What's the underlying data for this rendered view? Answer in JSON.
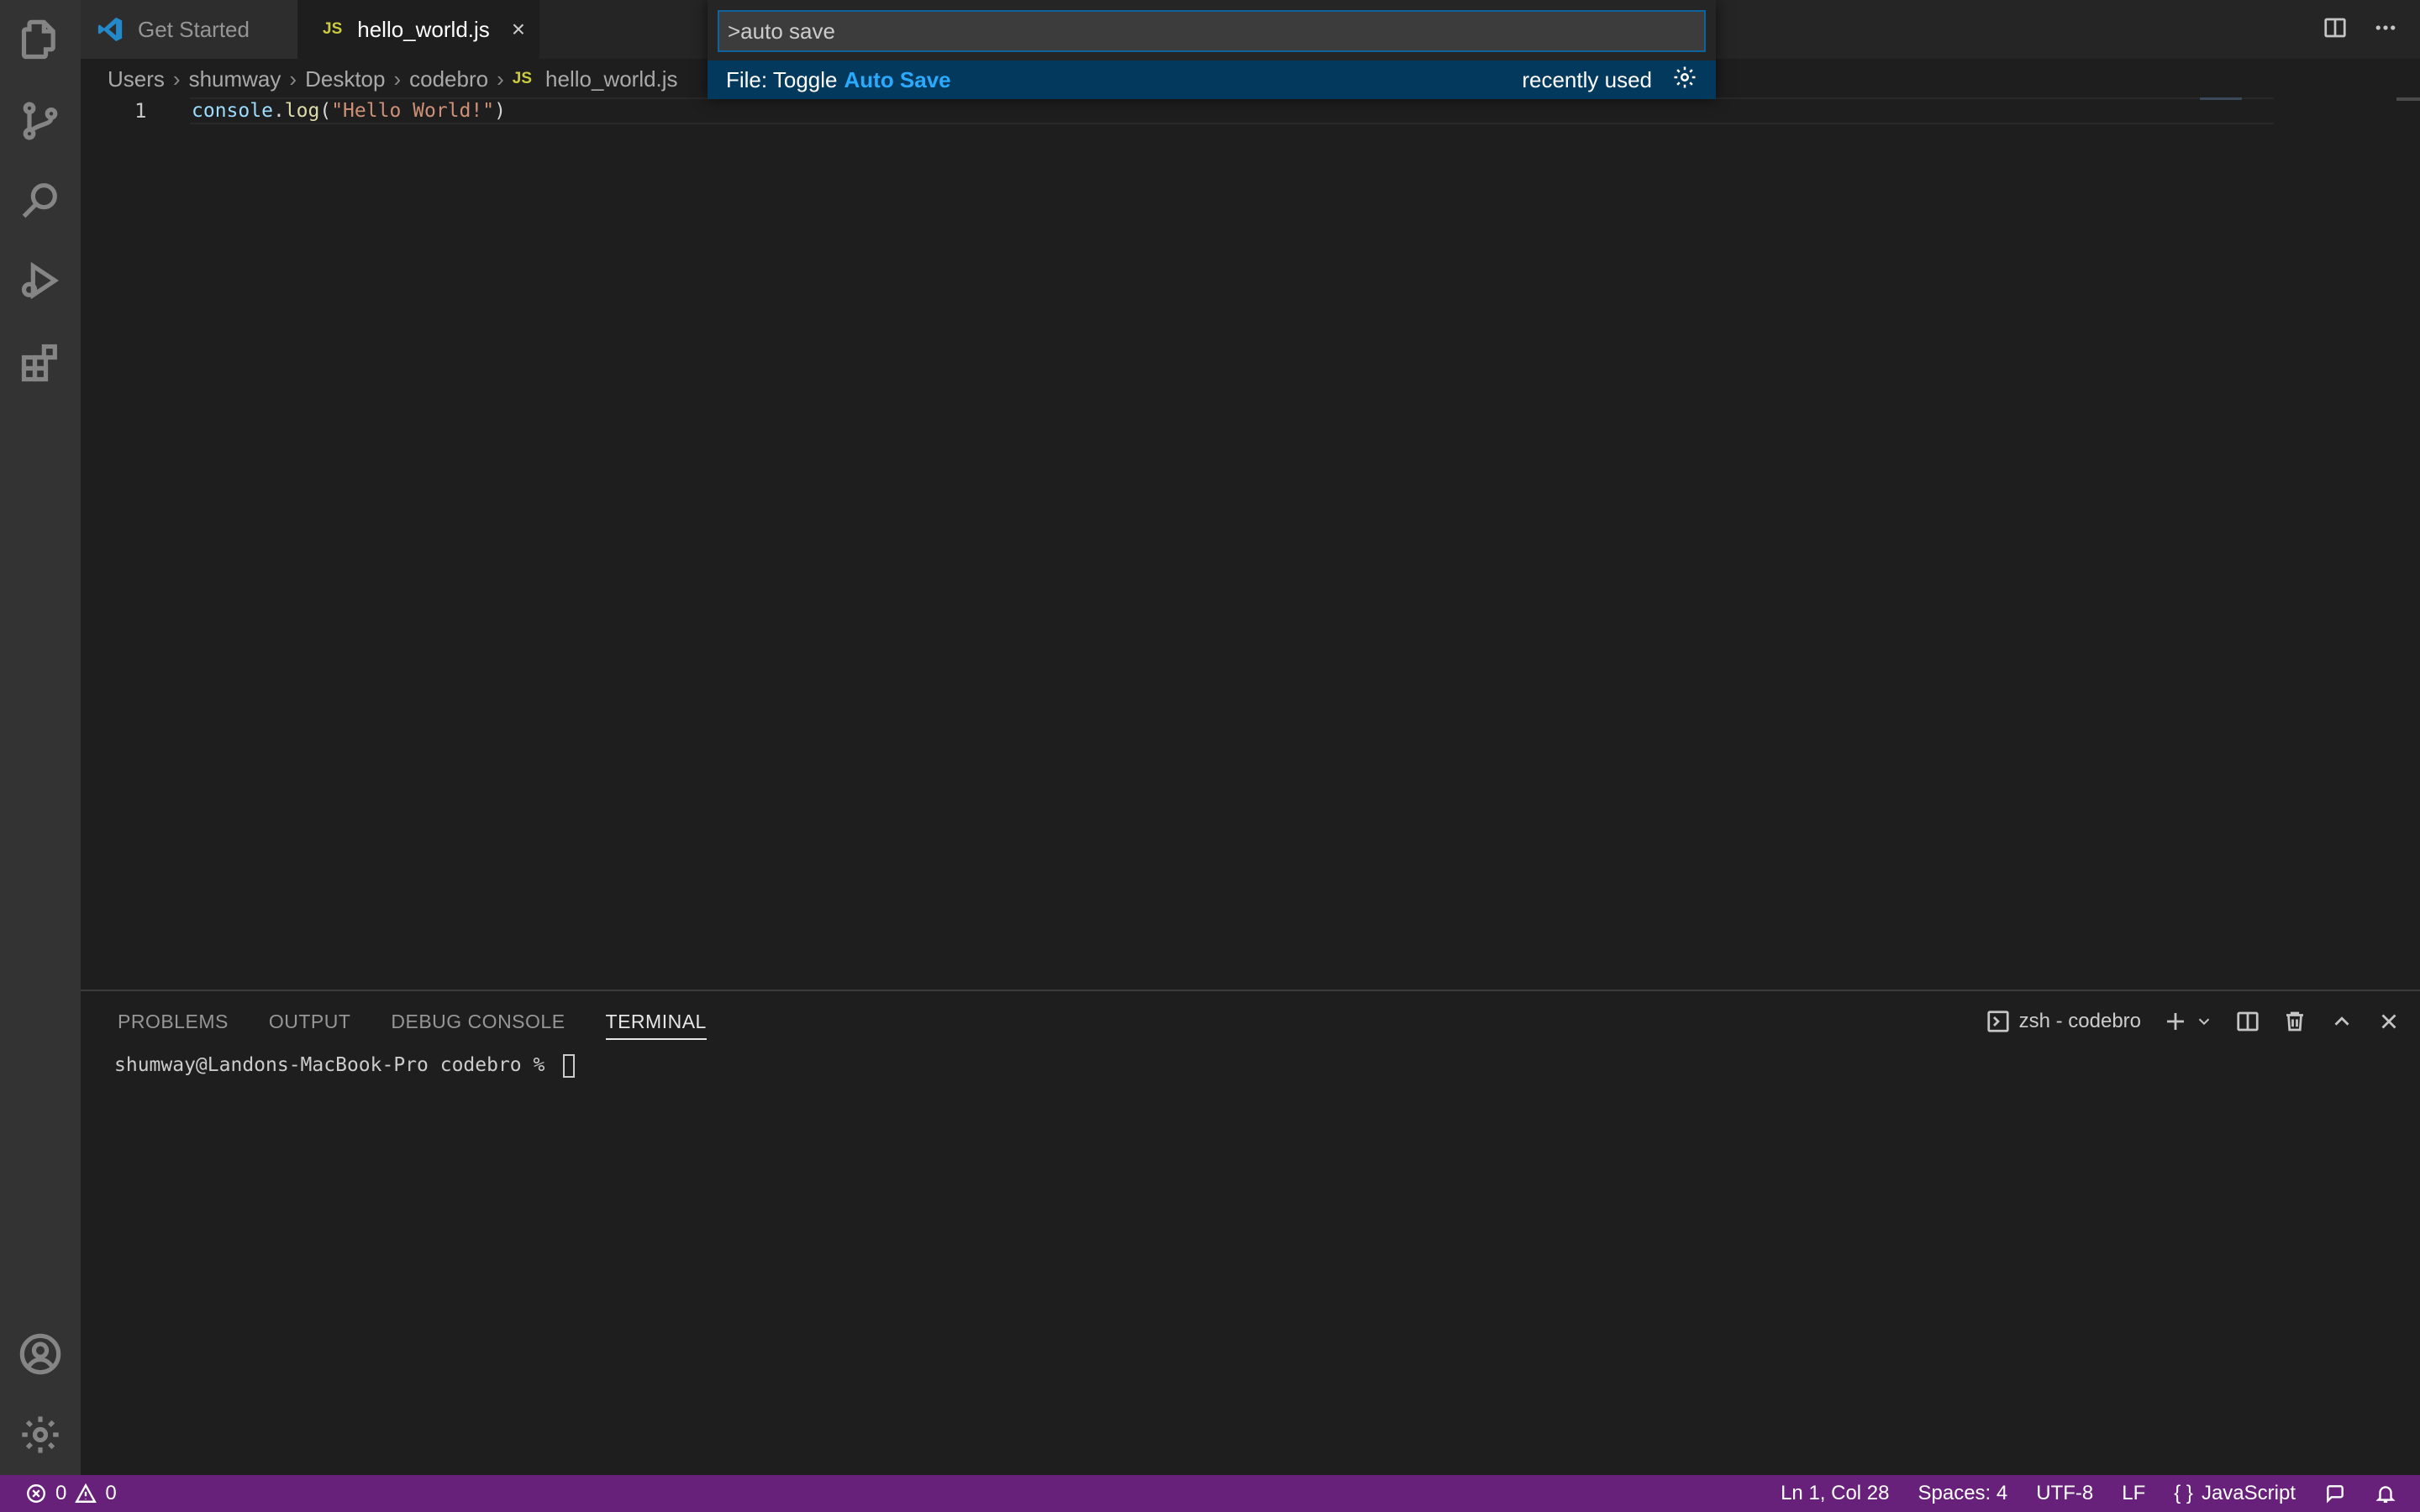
{
  "tabs": [
    {
      "label": "Get Started",
      "active": false
    },
    {
      "label": "hello_world.js",
      "badge": "JS",
      "active": true,
      "close": "×"
    }
  ],
  "breadcrumb": {
    "items": [
      "Users",
      "shumway",
      "Desktop",
      "codebro",
      "hello_world.js"
    ],
    "separator": "›",
    "file_badge": "JS"
  },
  "editor": {
    "line_number": "1",
    "code": {
      "obj": "console",
      "dot": ".",
      "fn": "log",
      "open": "(",
      "str": "\"Hello World!\"",
      "close": ")"
    }
  },
  "command_palette": {
    "input_value": ">auto save",
    "item": {
      "prefix": "File: Toggle",
      "match": "Auto Save",
      "tag": "recently used",
      "icon": "gear-icon"
    }
  },
  "panel": {
    "tabs": [
      "PROBLEMS",
      "OUTPUT",
      "DEBUG CONSOLE",
      "TERMINAL"
    ],
    "active_tab": "TERMINAL",
    "terminal_name": "zsh - codebro",
    "terminal_prompt": "shumway@Landons-MacBook-Pro codebro % "
  },
  "status_bar": {
    "errors": "0",
    "warnings": "0",
    "position": "Ln 1, Col 28",
    "spaces": "Spaces: 4",
    "encoding": "UTF-8",
    "eol": "LF",
    "language": "JavaScript",
    "language_icon": "{ }",
    "color": "#68217a"
  }
}
